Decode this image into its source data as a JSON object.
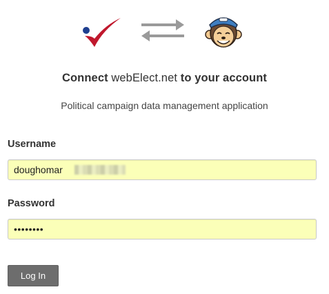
{
  "header": {
    "connect_prefix": "Connect",
    "app_name": "webElect.net",
    "connect_suffix": "to your account",
    "description": "Political campaign data management application"
  },
  "icons": {
    "left_logo": "webelect-checkmark-logo",
    "middle": "swap-arrows-icon",
    "right_logo": "mailchimp-freddie-logo"
  },
  "form": {
    "username_label": "Username",
    "username_value": "doughomar",
    "password_label": "Password",
    "password_value": "••••••••",
    "login_label": "Log In"
  },
  "colors": {
    "autofill_background": "#fbffb8",
    "button_background": "#6d6d6d",
    "checkmark_red": "#c0182d",
    "dot_blue": "#1f3f8f"
  }
}
